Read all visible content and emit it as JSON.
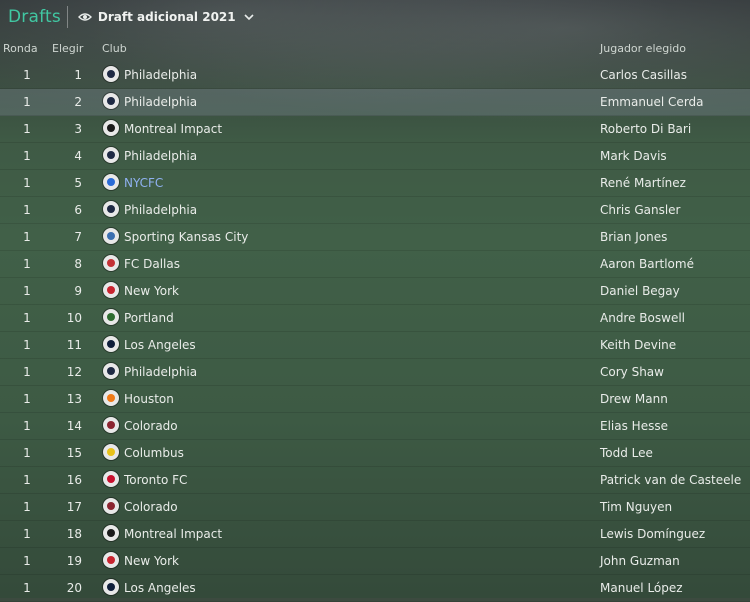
{
  "header": {
    "title": "Drafts",
    "view_label": "Draft adicional 2021"
  },
  "columns": {
    "ronda": "Ronda",
    "elegir": "Elegir",
    "club": "Club",
    "jugador": "Jugador elegido"
  },
  "rows": [
    {
      "ronda": "1",
      "elegir": "1",
      "club": "Philadelphia",
      "jugador": "Carlos Casillas",
      "crest_color": "#1f2a44"
    },
    {
      "ronda": "1",
      "elegir": "2",
      "club": "Philadelphia",
      "jugador": "Emmanuel Cerda",
      "crest_color": "#1f2a44"
    },
    {
      "ronda": "1",
      "elegir": "3",
      "club": "Montreal Impact",
      "jugador": "Roberto Di Bari",
      "crest_color": "#1a1a1a"
    },
    {
      "ronda": "1",
      "elegir": "4",
      "club": "Philadelphia",
      "jugador": "Mark Davis",
      "crest_color": "#1f2a44"
    },
    {
      "ronda": "1",
      "elegir": "5",
      "club": "NYCFC",
      "jugador": "René Martínez",
      "crest_color": "#2a6bd6"
    },
    {
      "ronda": "1",
      "elegir": "6",
      "club": "Philadelphia",
      "jugador": "Chris Gansler",
      "crest_color": "#1f2a44"
    },
    {
      "ronda": "1",
      "elegir": "7",
      "club": "Sporting Kansas City",
      "jugador": "Brian Jones",
      "crest_color": "#3b6fb0"
    },
    {
      "ronda": "1",
      "elegir": "8",
      "club": "FC Dallas",
      "jugador": "Aaron Bartlomé",
      "crest_color": "#c43136"
    },
    {
      "ronda": "1",
      "elegir": "9",
      "club": "New York",
      "jugador": "Daniel Begay",
      "crest_color": "#c8242f"
    },
    {
      "ronda": "1",
      "elegir": "10",
      "club": "Portland",
      "jugador": "Andre Boswell",
      "crest_color": "#2d6b2f"
    },
    {
      "ronda": "1",
      "elegir": "11",
      "club": "Los Angeles",
      "jugador": "Keith Devine",
      "crest_color": "#0f1e3a"
    },
    {
      "ronda": "1",
      "elegir": "12",
      "club": "Philadelphia",
      "jugador": "Cory Shaw",
      "crest_color": "#1f2a44"
    },
    {
      "ronda": "1",
      "elegir": "13",
      "club": "Houston",
      "jugador": "Drew Mann",
      "crest_color": "#f07a17"
    },
    {
      "ronda": "1",
      "elegir": "14",
      "club": "Colorado",
      "jugador": "Elias Hesse",
      "crest_color": "#8b2430"
    },
    {
      "ronda": "1",
      "elegir": "15",
      "club": "Columbus",
      "jugador": "Todd Lee",
      "crest_color": "#e8c21a"
    },
    {
      "ronda": "1",
      "elegir": "16",
      "club": "Toronto FC",
      "jugador": "Patrick van de Casteele",
      "crest_color": "#c8102e"
    },
    {
      "ronda": "1",
      "elegir": "17",
      "club": "Colorado",
      "jugador": "Tim Nguyen",
      "crest_color": "#8b2430"
    },
    {
      "ronda": "1",
      "elegir": "18",
      "club": "Montreal Impact",
      "jugador": "Lewis Domínguez",
      "crest_color": "#1a1a1a"
    },
    {
      "ronda": "1",
      "elegir": "19",
      "club": "New York",
      "jugador": "John Guzman",
      "crest_color": "#c8242f"
    },
    {
      "ronda": "1",
      "elegir": "20",
      "club": "Los Angeles",
      "jugador": "Manuel López",
      "crest_color": "#0f1e3a"
    }
  ],
  "highlight_row": 2,
  "link_row": 5,
  "colors": {
    "title": "#41c7a2",
    "link": "#8fb1f0"
  },
  "icons": {
    "view": "eye-icon",
    "dropdown": "chevron-down-icon",
    "club": "club-crest-icon"
  }
}
